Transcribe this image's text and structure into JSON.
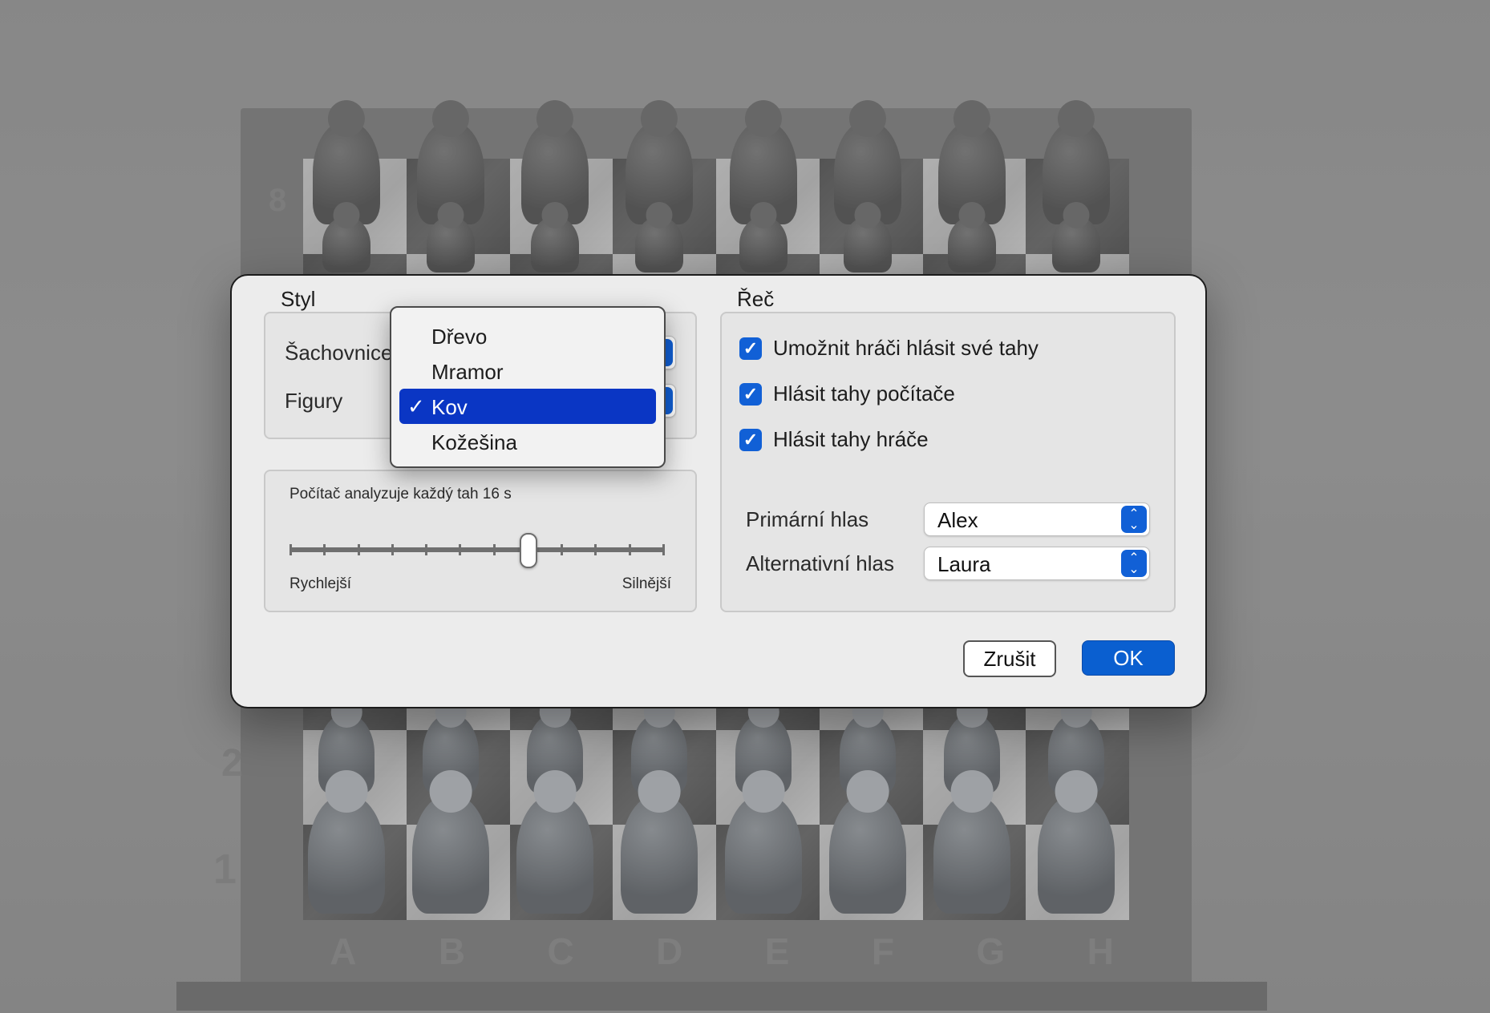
{
  "board": {
    "ranks": [
      "8",
      "2",
      "1"
    ],
    "files": [
      "A",
      "B",
      "C",
      "D",
      "E",
      "F",
      "G",
      "H"
    ]
  },
  "dialog": {
    "style_section": {
      "title": "Styl",
      "board_label": "Šachovnice",
      "pieces_label": "Figury"
    },
    "dropdown": {
      "items": [
        {
          "label": "Dřevo",
          "selected": false
        },
        {
          "label": "Mramor",
          "selected": false
        },
        {
          "label": "Kov",
          "selected": true
        },
        {
          "label": "Kožešina",
          "selected": false
        }
      ],
      "check_glyph": "✓"
    },
    "analysis": {
      "title": "Počítač analyzuje každý tah 16 s",
      "min_label": "Rychlejší",
      "max_label": "Silnější",
      "tick_count": 12,
      "level_fraction": 0.636
    },
    "speech_section": {
      "title": "Řeč",
      "checkboxes": [
        {
          "label": "Umožnit hráči hlásit své tahy",
          "checked": true
        },
        {
          "label": "Hlásit tahy počítače",
          "checked": true
        },
        {
          "label": "Hlásit tahy hráče",
          "checked": true
        }
      ],
      "primary_voice_label": "Primární hlas",
      "primary_voice_value": "Alex",
      "alt_voice_label": "Alternativní hlas",
      "alt_voice_value": "Laura"
    },
    "buttons": {
      "cancel": "Zrušit",
      "ok": "OK"
    }
  },
  "colors": {
    "accent": "#1160d6",
    "menu_selection": "#0a36c4"
  }
}
